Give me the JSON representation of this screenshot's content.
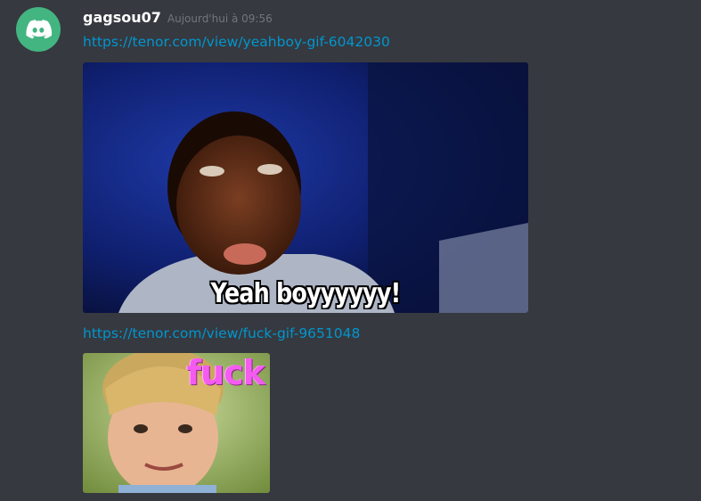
{
  "message": {
    "author": "gagsou07",
    "timestamp": "Aujourd'hui à 09:56",
    "avatar_icon": "discord-logo-icon",
    "avatar_color": "#43b581"
  },
  "links": [
    {
      "text": "https://tenor.com/view/yeahboy-gif-6042030"
    },
    {
      "text": "https://tenor.com/view/fuck-gif-9651048"
    }
  ],
  "embeds": [
    {
      "caption": "Yeah boyyyyyy!"
    },
    {
      "caption": "fuck"
    }
  ],
  "colors": {
    "background": "#36393f",
    "link": "#0096cf",
    "username": "#ffffff",
    "timestamp": "#72767d"
  }
}
